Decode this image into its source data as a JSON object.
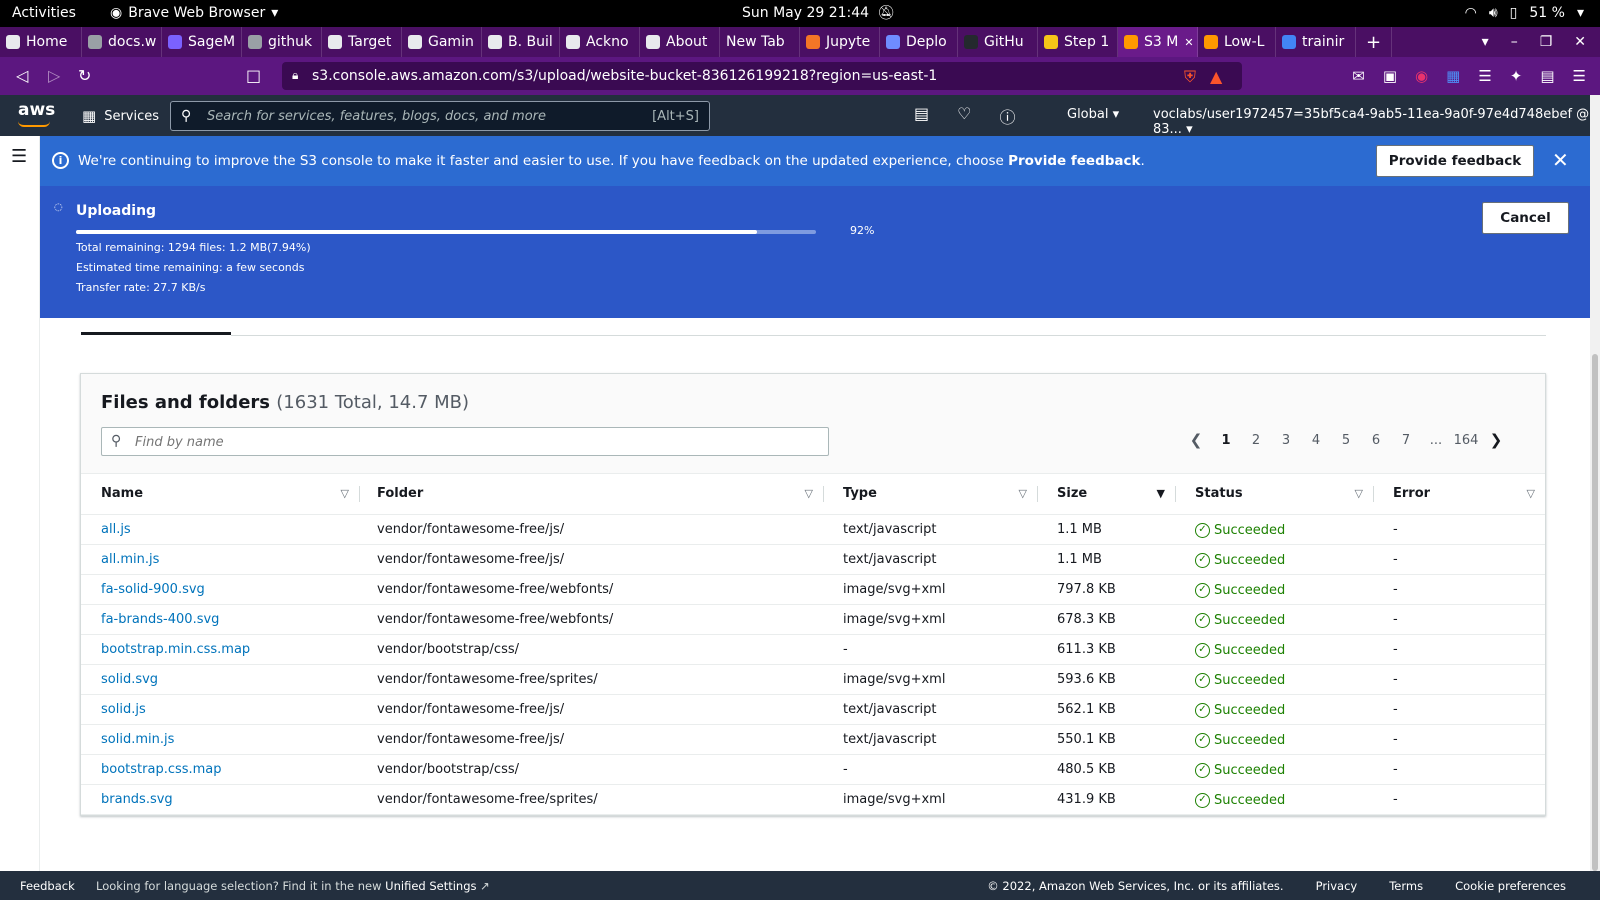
{
  "os_bar": {
    "activities": "Activities",
    "app_name": "Brave Web Browser",
    "clock": "Sun May 29  21:44",
    "battery": "51 %"
  },
  "tabs": [
    {
      "label": "Home",
      "color": "#e8eaed"
    },
    {
      "label": "docs.w",
      "color": "#9aa0a6"
    },
    {
      "label": "SageM",
      "color": "#7b61ff"
    },
    {
      "label": "githuk",
      "color": "#9aa0a6"
    },
    {
      "label": "Target",
      "color": "#e8eaed"
    },
    {
      "label": "Gamin",
      "color": "#e8eaed"
    },
    {
      "label": "B. Buil",
      "color": "#e8eaed"
    },
    {
      "label": "Ackno",
      "color": "#e8eaed"
    },
    {
      "label": "About",
      "color": "#e8eaed"
    },
    {
      "label": "New Tab",
      "color": ""
    },
    {
      "label": "Jupyte",
      "color": "#f37626"
    },
    {
      "label": "Deplo",
      "color": "#6f8cff"
    },
    {
      "label": "GitHu",
      "color": "#24292e"
    },
    {
      "label": "Step 1",
      "color": "#f5c518"
    },
    {
      "label": "S3 M",
      "color": "#ff9900"
    },
    {
      "label": "Low-L",
      "color": "#ff9900"
    },
    {
      "label": "trainir",
      "color": "#4285f4"
    }
  ],
  "address": {
    "url": "s3.console.aws.amazon.com/s3/upload/website-bucket-836126199218?region=us-east-1"
  },
  "aws_header": {
    "logo": "aws",
    "services": "Services",
    "search_placeholder": "Search for services, features, blogs, docs, and more",
    "search_shortcut": "[Alt+S]",
    "region": "Global",
    "account": "voclabs/user1972457=35bf5ca4-9ab5-11ea-9a0f-97e4d748ebef @ 83..."
  },
  "banner": {
    "message": "We're continuing to improve the S3 console to make it faster and easier to use. If you have feedback on the updated experience, choose",
    "message_link": "Provide feedback",
    "button": "Provide feedback"
  },
  "upload": {
    "title": "Uploading",
    "progress_pct_label": "92%",
    "progress_fraction": 0.92,
    "total_remaining": "Total remaining: 1294 files: 1.2 MB(7.94%)",
    "eta": "Estimated time remaining: a few seconds",
    "rate": "Transfer rate: 27.7 KB/s",
    "cancel": "Cancel"
  },
  "files": {
    "heading": "Files and folders",
    "count": "(1631 Total, 14.7 MB)",
    "find_placeholder": "Find by name",
    "pages": [
      "1",
      "2",
      "3",
      "4",
      "5",
      "6",
      "7",
      "...",
      "164"
    ],
    "current_page": "1",
    "columns": [
      "Name",
      "Folder",
      "Type",
      "Size",
      "Status",
      "Error"
    ],
    "rows": [
      {
        "name": "all.js",
        "folder": "vendor/fontawesome-free/js/",
        "type": "text/javascript",
        "size": "1.1 MB",
        "status": "Succeeded",
        "error": "-"
      },
      {
        "name": "all.min.js",
        "folder": "vendor/fontawesome-free/js/",
        "type": "text/javascript",
        "size": "1.1 MB",
        "status": "Succeeded",
        "error": "-"
      },
      {
        "name": "fa-solid-900.svg",
        "folder": "vendor/fontawesome-free/webfonts/",
        "type": "image/svg+xml",
        "size": "797.8 KB",
        "status": "Succeeded",
        "error": "-"
      },
      {
        "name": "fa-brands-400.svg",
        "folder": "vendor/fontawesome-free/webfonts/",
        "type": "image/svg+xml",
        "size": "678.3 KB",
        "status": "Succeeded",
        "error": "-"
      },
      {
        "name": "bootstrap.min.css.map",
        "folder": "vendor/bootstrap/css/",
        "type": "-",
        "size": "611.3 KB",
        "status": "Succeeded",
        "error": "-"
      },
      {
        "name": "solid.svg",
        "folder": "vendor/fontawesome-free/sprites/",
        "type": "image/svg+xml",
        "size": "593.6 KB",
        "status": "Succeeded",
        "error": "-"
      },
      {
        "name": "solid.js",
        "folder": "vendor/fontawesome-free/js/",
        "type": "text/javascript",
        "size": "562.1 KB",
        "status": "Succeeded",
        "error": "-"
      },
      {
        "name": "solid.min.js",
        "folder": "vendor/fontawesome-free/js/",
        "type": "text/javascript",
        "size": "550.1 KB",
        "status": "Succeeded",
        "error": "-"
      },
      {
        "name": "bootstrap.css.map",
        "folder": "vendor/bootstrap/css/",
        "type": "-",
        "size": "480.5 KB",
        "status": "Succeeded",
        "error": "-"
      },
      {
        "name": "brands.svg",
        "folder": "vendor/fontawesome-free/sprites/",
        "type": "image/svg+xml",
        "size": "431.9 KB",
        "status": "Succeeded",
        "error": "-"
      }
    ]
  },
  "footer": {
    "feedback": "Feedback",
    "lang_text": "Looking for language selection? Find it in the new",
    "lang_link": "Unified Settings",
    "copyright": "© 2022, Amazon Web Services, Inc. or its affiliates.",
    "privacy": "Privacy",
    "terms": "Terms",
    "cookies": "Cookie preferences"
  },
  "colors": {
    "aws_navy": "#232f3e",
    "banner_blue": "#2c6bd1",
    "upload_blue": "#2c57c7",
    "link_blue": "#0073bb",
    "success_green": "#1d8102",
    "brave_purple": "#4a0f63"
  }
}
